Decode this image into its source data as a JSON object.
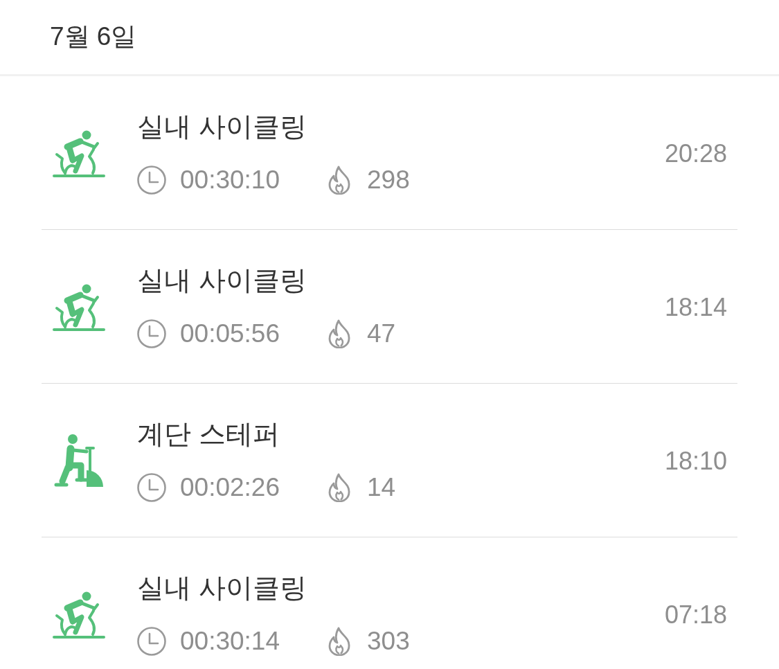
{
  "date_header": "7월 6일",
  "workouts": [
    {
      "kind": "cycling",
      "title": "실내 사이클링",
      "duration": "00:30:10",
      "calories": "298",
      "time": "20:28"
    },
    {
      "kind": "cycling",
      "title": "실내 사이클링",
      "duration": "00:05:56",
      "calories": "47",
      "time": "18:14"
    },
    {
      "kind": "stepper",
      "title": "계단 스테퍼",
      "duration": "00:02:26",
      "calories": "14",
      "time": "18:10"
    },
    {
      "kind": "cycling",
      "title": "실내 사이클링",
      "duration": "00:30:14",
      "calories": "303",
      "time": "07:18"
    }
  ]
}
